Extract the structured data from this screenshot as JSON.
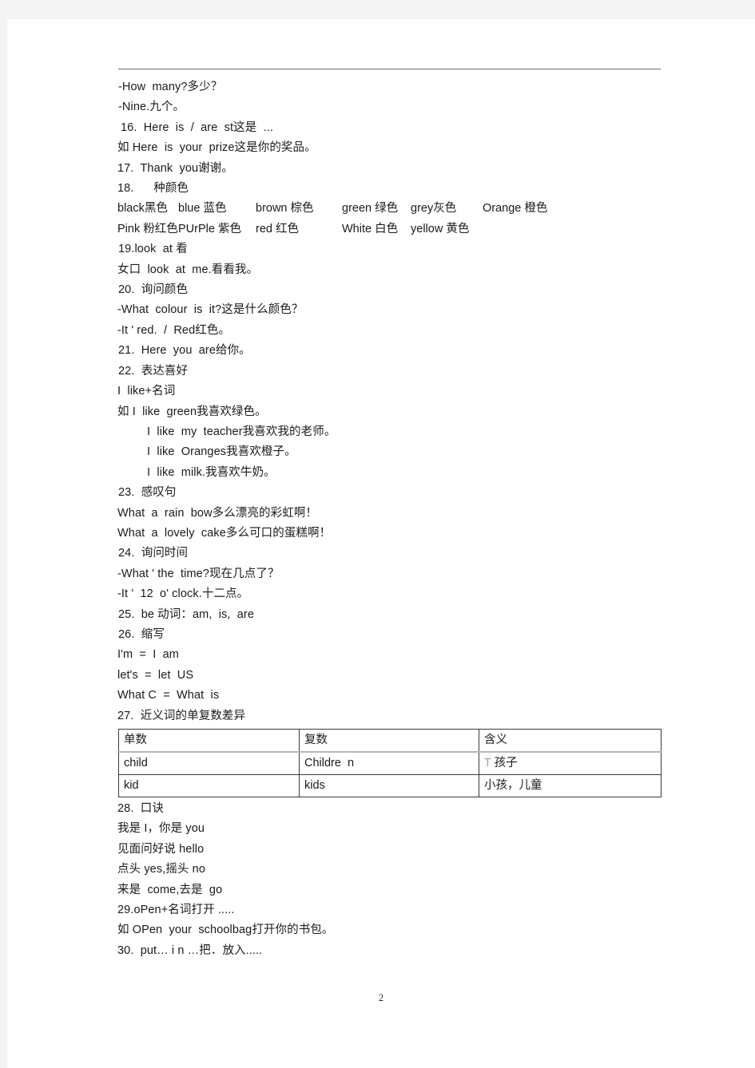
{
  "document": {
    "page_number": "2",
    "body_lines": [
      {
        "indent": "ind-1",
        "text": "-How  many?多少？"
      },
      {
        "indent": "ind-1",
        "text": "-Nine.九个。"
      },
      {
        "indent": "ind-2",
        "text": "16.  Here  is  /  are  st这是  ..."
      },
      {
        "indent": "ind-0",
        "text": "如 Here  is  your  prize这是你的奖品。"
      },
      {
        "indent": "ind-0",
        "text": "17.  Thank  you谢谢。"
      },
      {
        "indent": "ind-0",
        "text": "18.      种颜色"
      }
    ],
    "color_rows": [
      [
        {
          "text": "black黑色",
          "width": "w1"
        },
        {
          "text": "blue 蓝色",
          "width": "w2"
        },
        {
          "text": "brown 棕色",
          "width": "w3"
        },
        {
          "text": "green 绿色",
          "width": "w4"
        },
        {
          "text": "grey灰色",
          "width": "w5"
        },
        {
          "text": "Orange 橙色",
          "width": ""
        }
      ],
      [
        {
          "text": "Pink 粉红色",
          "width": "w1"
        },
        {
          "text": "PUrPle 紫色",
          "width": "w2"
        },
        {
          "text": "red 红色",
          "width": "w3"
        },
        {
          "text": "White 白色",
          "width": "w4"
        },
        {
          "text": "yellow 黄色",
          "width": ""
        }
      ]
    ],
    "body_lines_2": [
      {
        "indent": "ind-1",
        "text": "19.look  at 看"
      },
      {
        "indent": "ind-0",
        "text": "女口  look  at  me.看看我。"
      },
      {
        "indent": "ind-1",
        "text": "20.  询问颜色"
      },
      {
        "indent": "ind-0",
        "text": "-What  colour  is  it?这是什么颜色？"
      },
      {
        "indent": "ind-0",
        "text": "-It ' red.  /  Red红色。"
      },
      {
        "indent": "ind-1",
        "text": "21.  Here  you  are给你。"
      },
      {
        "indent": "ind-1",
        "text": "22.  表达喜好"
      },
      {
        "indent": "ind-0",
        "text": "I  like+名词"
      },
      {
        "indent": "ind-0",
        "text": "如 I  like  green我喜欢绿色。"
      },
      {
        "indent": "ind-3",
        "text": "I  like  my  teacher我喜欢我的老师。"
      },
      {
        "indent": "ind-3",
        "text": "I  like  Oranges我喜欢橙子。"
      },
      {
        "indent": "ind-3",
        "text": "I  like  milk.我喜欢牛奶。"
      },
      {
        "indent": "ind-1",
        "text": "23.  感叹句"
      },
      {
        "indent": "ind-0",
        "text": "What  a  rain  bow多么漂亮的彩虹啊！"
      },
      {
        "indent": "ind-0",
        "text": "What  a  lovely  cake多么可口的蛋糕啊！"
      },
      {
        "indent": "ind-1",
        "text": "24.  询问时间"
      },
      {
        "indent": "ind-0",
        "text": "-What ' the  time?现在几点了？"
      },
      {
        "indent": "ind-0",
        "text": "-It '  12  o' clock.十二点。"
      },
      {
        "indent": "ind-1",
        "text": "25.  be 动词：am,  is,  are"
      },
      {
        "indent": "ind-1",
        "text": "26.  缩写"
      },
      {
        "indent": "ind-0",
        "text": "I'm  =  I  am"
      },
      {
        "indent": "ind-0",
        "text": "let's  =  let  US"
      },
      {
        "indent": "ind-0",
        "text": "What C  =  What  is"
      },
      {
        "indent": "ind-0",
        "text": "27.  近义词的单复数差异"
      }
    ],
    "table": {
      "headers": [
        "单数",
        "复数",
        "含义"
      ],
      "rows": [
        [
          "child",
          "Childre  n",
          "T 孩子"
        ],
        [
          "kid",
          "kids",
          "小孩，儿童"
        ]
      ]
    },
    "body_lines_3": [
      {
        "indent": "ind-0",
        "text": "28.  口诀"
      },
      {
        "indent": "ind-0",
        "text": "我是 I，你是 you"
      },
      {
        "indent": "ind-0",
        "text": "见面问好说 hello"
      },
      {
        "indent": "ind-0",
        "text": "点头 yes,摇头 no"
      },
      {
        "indent": "ind-0",
        "text": "来是  come,去是  go"
      },
      {
        "indent": "ind-0",
        "text": "29.oPen+名词打开 ....."
      },
      {
        "indent": "ind-0",
        "text": "如 OPen  your  schoolbag打开你的书包。"
      },
      {
        "indent": "ind-0",
        "text": "30.  put… i n …把．放入....."
      }
    ]
  }
}
